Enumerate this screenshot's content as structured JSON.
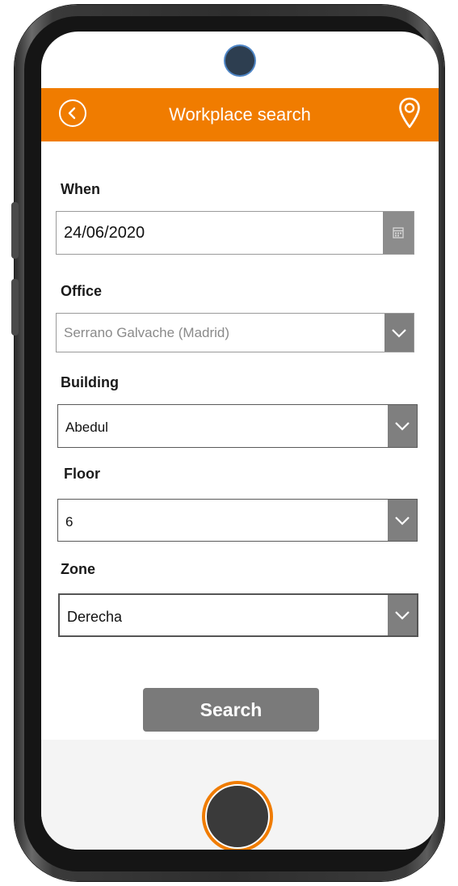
{
  "header": {
    "title": "Workplace search",
    "back_icon": "chevron-left-circle-icon",
    "location_icon": "map-pin-icon"
  },
  "form": {
    "when": {
      "label": "When",
      "value": "24/06/2020",
      "icon": "calendar-icon"
    },
    "office": {
      "label": "Office",
      "value": "Serrano Galvache (Madrid)"
    },
    "building": {
      "label": "Building",
      "value": "Abedul"
    },
    "floor": {
      "label": "Floor",
      "value": "6"
    },
    "zone": {
      "label": "Zone",
      "value": "Derecha"
    }
  },
  "actions": {
    "search_label": "Search"
  },
  "colors": {
    "accent": "#f07c00",
    "button_gray": "#7a7a7a",
    "dropdown_gray": "#7f7f7f"
  }
}
